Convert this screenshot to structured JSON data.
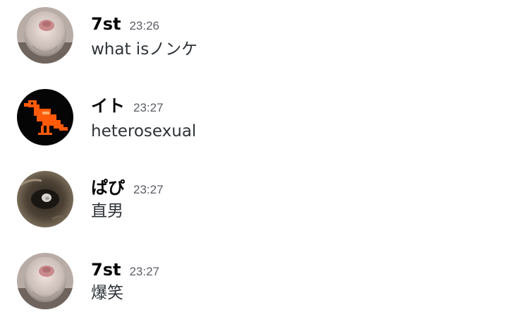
{
  "messages": [
    {
      "username": "7st",
      "timestamp": "23:26",
      "content": "what isノンケ",
      "avatar_icon": "pink-blob-avatar-icon"
    },
    {
      "username": "イト",
      "timestamp": "23:27",
      "content": "heterosexual",
      "avatar_icon": "orange-pixel-bird-avatar-icon"
    },
    {
      "username": "ぱぴ",
      "timestamp": "23:27",
      "content": "直男",
      "avatar_icon": "tree-hollow-photo-avatar-icon"
    },
    {
      "username": "7st",
      "timestamp": "23:27",
      "content": "爆笑",
      "avatar_icon": "pink-blob-avatar-icon"
    }
  ],
  "colors": {
    "background": "#ffffff",
    "username": "#060607",
    "timestamp": "#5c5e66",
    "content": "#2e3338",
    "bird_orange": "#ff5a0a",
    "bird_avatar_bg": "#050505"
  }
}
